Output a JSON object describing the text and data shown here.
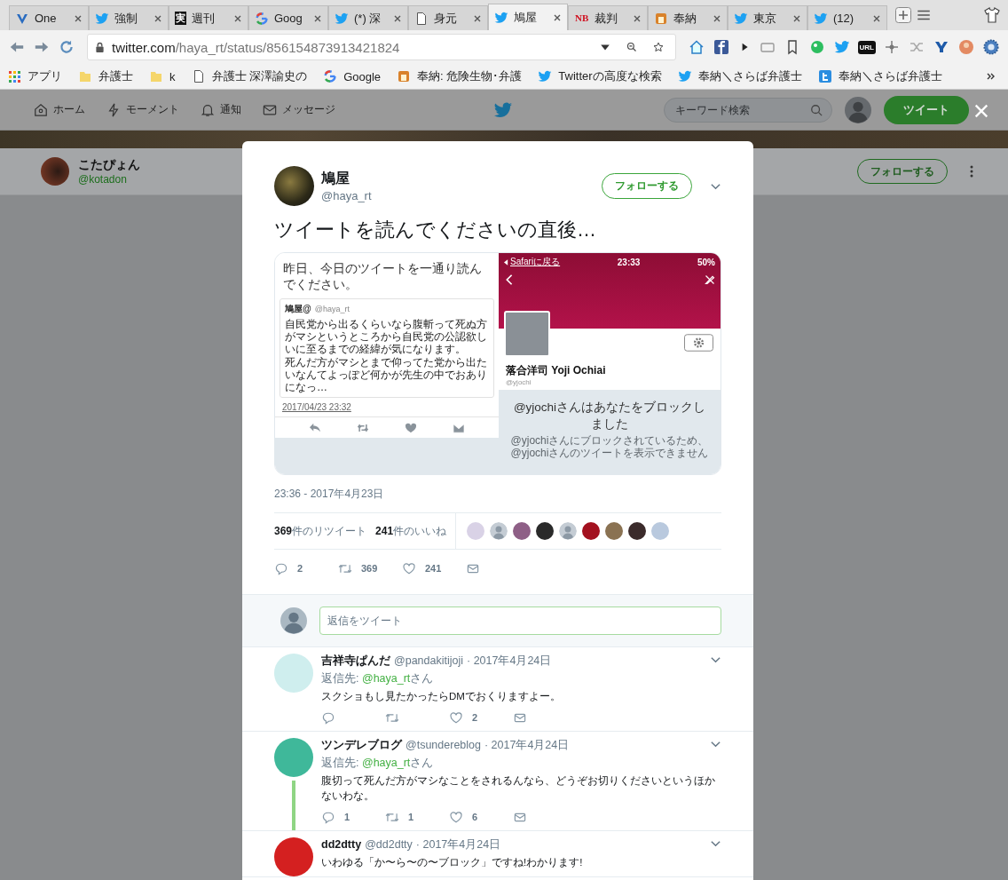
{
  "browser": {
    "tabs": [
      {
        "title": "One",
        "kind": "vivaldi",
        "selected": false
      },
      {
        "title": "強制",
        "kind": "twitter",
        "selected": false
      },
      {
        "title": "週刊",
        "kind": "text",
        "logo_text": "実",
        "selected": false
      },
      {
        "title": "Goog",
        "kind": "google",
        "selected": false
      },
      {
        "title": "(*) 深",
        "kind": "twitter",
        "selected": false
      },
      {
        "title": "身元",
        "kind": "page",
        "selected": false
      },
      {
        "title": "鳩屋",
        "kind": "twitter",
        "selected": true
      },
      {
        "title": "裁判",
        "kind": "textred",
        "logo_text": "NB",
        "selected": false
      },
      {
        "title": "奉納",
        "kind": "picture",
        "selected": false
      },
      {
        "title": "東京",
        "kind": "twitter",
        "selected": false
      },
      {
        "title": "(12)",
        "kind": "twitter",
        "selected": false
      }
    ],
    "address": {
      "host": "twitter.com",
      "path": "/haya_rt/status/856154873913421824"
    },
    "url_badge": "URL",
    "bookmarks": [
      {
        "label": "アプリ",
        "kind": "apps"
      },
      {
        "label": "弁護士",
        "kind": "folder"
      },
      {
        "label": "k",
        "kind": "folder"
      },
      {
        "label": "弁護士 深澤諭史の",
        "kind": "page"
      },
      {
        "label": "Google",
        "kind": "google"
      },
      {
        "label": "奉納: 危険生物･弁護",
        "kind": "picture"
      },
      {
        "label": "Twitterの高度な検索",
        "kind": "twitter"
      },
      {
        "label": "奉納＼さらば弁護士",
        "kind": "twitter"
      },
      {
        "label": "奉納＼さらば弁護士",
        "kind": "tsquare"
      }
    ]
  },
  "nav": {
    "items": [
      {
        "label": "ホーム",
        "kind": "home"
      },
      {
        "label": "モーメント",
        "kind": "bolt"
      },
      {
        "label": "通知",
        "kind": "bell"
      },
      {
        "label": "メッセージ",
        "kind": "mail"
      }
    ],
    "search": {
      "placeholder": "キーワード検索"
    },
    "tweet_button": "ツイート"
  },
  "profile": {
    "name": "こたぴょん",
    "handle": "@kotadon",
    "follow_button": "フォローする"
  },
  "tweet": {
    "name": "鳩屋",
    "handle": "@haya_rt",
    "follow_button": "フォローする",
    "text": "ツイートを読んでくださいの直後…",
    "image": {
      "left": {
        "text": "昨日、今日のツイートを一通り読んでください。",
        "quote_name": "鳩屋@",
        "quote_handle": "@haya_rt",
        "quote_text": [
          "自民党から出るくらいなら腹斬って死ぬ方がマシというところから自民党の公認欲しいに至るまでの経緯が気になります。",
          "死んだ方がマシとまで仰ってた党から出たいなんてよっぽど何かが先生の中でおありになっ…"
        ],
        "date": "2017/04/23 23:32"
      },
      "right": {
        "back": "Safariに戻る",
        "time": "23:33",
        "battery": "50%",
        "name": "落合洋司 Yoji Ochiai",
        "handle": "@yjochi",
        "blocked": "@yjochiさんはあなたをブロックしました",
        "note": [
          "@yjochiさんにブロックされているため、",
          "@yjochiさんのツイートを表示できません"
        ]
      }
    },
    "timestamp": "23:36 - 2017年4月23日",
    "retweets": {
      "count": "369",
      "label": "件のリツイート"
    },
    "likes": {
      "count": "241",
      "label": "件のいいね"
    },
    "likers": [
      {
        "kind": "picture",
        "color": "#d9d2e6"
      },
      {
        "kind": "default",
        "color": "#c4ccd4"
      },
      {
        "kind": "picture",
        "color": "#8e5f86"
      },
      {
        "kind": "picture",
        "color": "#2a2a2a"
      },
      {
        "kind": "default",
        "color": "#c4ccd4"
      },
      {
        "kind": "picture",
        "color": "#a3111f"
      },
      {
        "kind": "picture",
        "color": "#8a7252"
      },
      {
        "kind": "picture",
        "color": "#3b2b2b"
      },
      {
        "kind": "picture",
        "color": "#b9c9de"
      }
    ],
    "actions": [
      {
        "kind": "reply",
        "count": "2"
      },
      {
        "kind": "retweet",
        "count": "369"
      },
      {
        "kind": "like",
        "count": "241"
      },
      {
        "kind": "dm"
      }
    ]
  },
  "compose": {
    "placeholder": "返信をツイート"
  },
  "replies": [
    {
      "name": "吉祥寺ぱんだ",
      "handle": "@pandakitijoji",
      "date": "· 2017年4月24日",
      "reply_prefix": "返信先: ",
      "reply_handle": "@haya_rt",
      "reply_suffix": "さん",
      "text": "スクショもし見たかったらDMでおくりますよー。",
      "thread_line": false,
      "actions": [
        {
          "kind": "reply"
        },
        {
          "kind": "retweet"
        },
        {
          "kind": "like",
          "count": "2"
        },
        {
          "kind": "dm"
        }
      ]
    },
    {
      "name": "ツンデレブログ",
      "handle": "@tsundereblog",
      "date": "· 2017年4月24日",
      "reply_prefix": "返信先: ",
      "reply_handle": "@haya_rt",
      "reply_suffix": "さん",
      "text": "腹切って死んだ方がマシなことをされるんなら、どうぞお切りくださいというほかないわな。",
      "thread_line": true,
      "actions": [
        {
          "kind": "reply",
          "count": "1"
        },
        {
          "kind": "retweet",
          "count": "1"
        },
        {
          "kind": "like",
          "count": "6"
        },
        {
          "kind": "dm"
        }
      ]
    },
    {
      "name": "dd2dtty",
      "handle": "@dd2dtty",
      "date": "· 2017年4月24日",
      "text": "いわゆる「か〜ら〜の〜ブロック」ですね!わかります!",
      "thread_line": false
    }
  ]
}
